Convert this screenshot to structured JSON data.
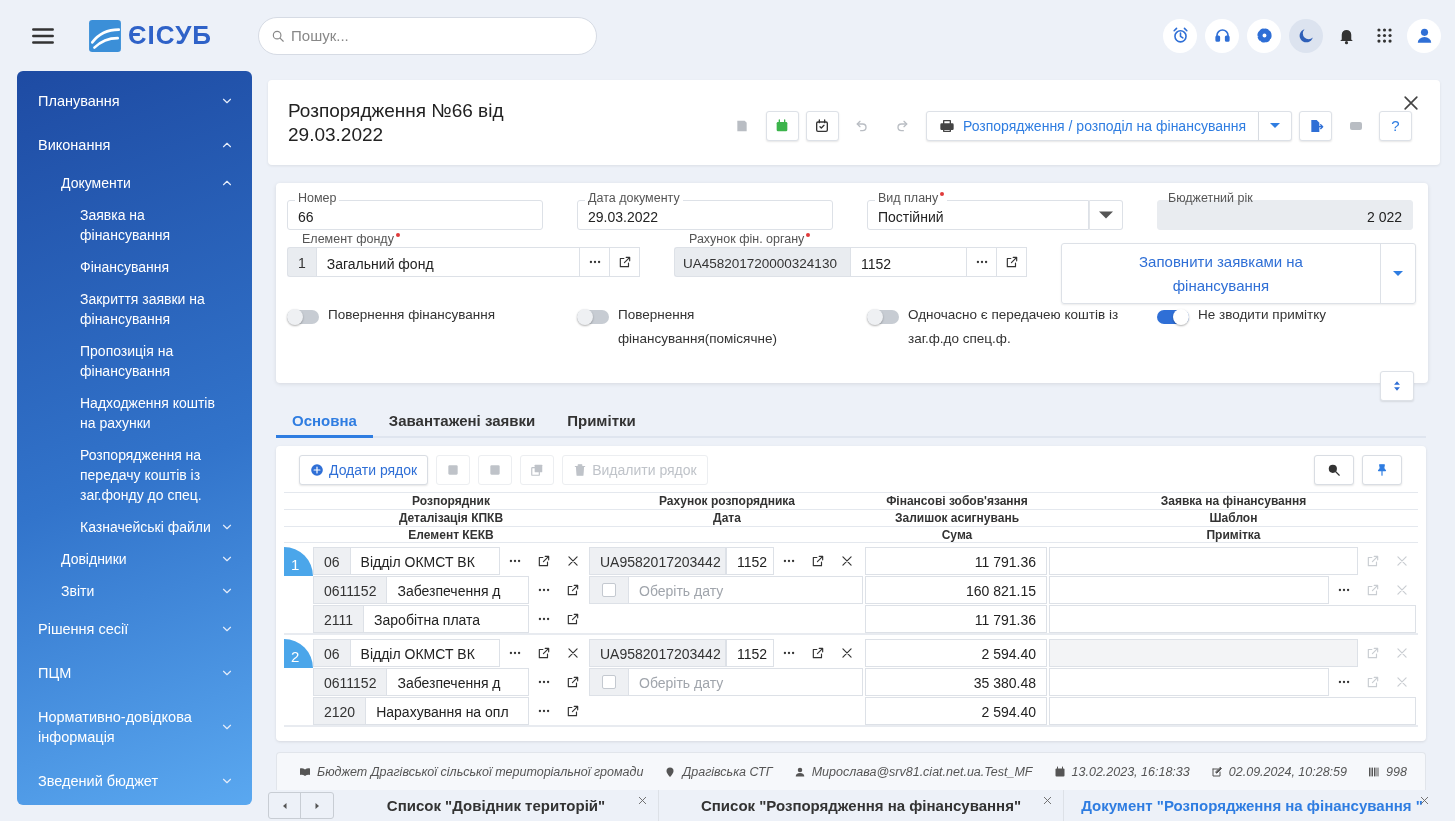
{
  "header": {
    "app_name": "ЄІСУБ",
    "search": {
      "placeholder": "Пошук..."
    }
  },
  "sidebar": {
    "items": [
      {
        "label": "Планування",
        "expanded": false
      },
      {
        "label": "Виконання",
        "expanded": true,
        "children": [
          {
            "label": "Документи",
            "expanded": true,
            "children": [
              {
                "label": "Заявка на фінансування"
              },
              {
                "label": "Фінансування"
              },
              {
                "label": "Закриття заявки на фінансування"
              },
              {
                "label": "Пропозиція на фінансування"
              },
              {
                "label": "Надходження коштів на рахунки"
              },
              {
                "label": "Розпорядження на передачу коштів із заг.фонду до спец."
              },
              {
                "label": "Казначейські файли",
                "expanded": false
              }
            ]
          },
          {
            "label": "Довідники",
            "expanded": false
          },
          {
            "label": "Звіти",
            "expanded": false
          }
        ]
      },
      {
        "label": "Рішення сесії",
        "expanded": false
      },
      {
        "label": "ПЦМ",
        "expanded": false
      },
      {
        "label": "Нормативно-довідкова інформація",
        "expanded": false
      },
      {
        "label": "Зведений бюджет",
        "expanded": false
      }
    ]
  },
  "document": {
    "title": "Розпорядження №66 від 29.03.2022",
    "toolbar": [
      {
        "kind": "save",
        "disabled": true
      },
      {
        "kind": "approve",
        "disabled": false
      },
      {
        "kind": "calendar",
        "disabled": false
      },
      {
        "kind": "undo",
        "disabled": true
      },
      {
        "kind": "redo",
        "disabled": true
      },
      {
        "kind": "print",
        "label": "Розпорядження / розподіл на фінансування",
        "disabled": false
      },
      {
        "kind": "export",
        "disabled": false
      },
      {
        "kind": "video",
        "disabled": true
      },
      {
        "kind": "help",
        "label": "?",
        "disabled": false
      }
    ]
  },
  "form": {
    "fields": [
      {
        "label": "Номер",
        "value": "66",
        "required": false,
        "disabled": false,
        "dropdown": false
      },
      {
        "label": "Дата документу",
        "value": "29.03.2022",
        "required": false,
        "disabled": false,
        "dropdown": false
      },
      {
        "label": "Вид плану",
        "value": "Постійний",
        "required": true,
        "disabled": false,
        "dropdown": true
      },
      {
        "label": "Бюджетний рік",
        "value": "2 022",
        "required": false,
        "disabled": true,
        "dropdown": false
      }
    ],
    "lookups": [
      {
        "label": "Елемент фонду",
        "code": "1",
        "value": "Загальний фонд",
        "required": true
      },
      {
        "label": "Рахунок фін. органу",
        "code": "UA458201720000324130",
        "value": "1152",
        "required": true
      }
    ],
    "fill_button": {
      "label": "Заповнити заявками на фінансування"
    },
    "toggles": [
      {
        "label": "Повернення фінансування",
        "on": false
      },
      {
        "label": "Повернення фінансування(помісячне)",
        "on": false
      },
      {
        "label": "Одночасно є передачею коштів із заг.ф.до спец.ф.",
        "on": false
      },
      {
        "label": "Не зводити примітку",
        "on": true
      }
    ]
  },
  "tabs": [
    {
      "label": "Основна",
      "selected": true
    },
    {
      "label": "Завантажені заявки",
      "selected": false
    },
    {
      "label": "Примітки",
      "selected": false
    }
  ],
  "table": {
    "toolbar": [
      {
        "kind": "add",
        "label": "Додати рядок",
        "disabled": false
      },
      {
        "kind": "up",
        "disabled": true
      },
      {
        "kind": "down",
        "disabled": true
      },
      {
        "kind": "copy",
        "disabled": true
      },
      {
        "kind": "delete",
        "label": "Видалити рядок",
        "disabled": true
      }
    ],
    "header_rows": [
      [
        "Розпорядник",
        "Рахунок розпорядника",
        "Фінансові зобов'язання",
        "Заявка на фінансування"
      ],
      [
        "Деталізація КПКВ",
        "Дата",
        "Залишок асигнувань",
        "Шаблон"
      ],
      [
        "Елемент КЕКВ",
        null,
        "Сума",
        "Примітка"
      ]
    ],
    "rows": [
      {
        "number": "1",
        "manager_code": "06",
        "manager_name": "Відділ ОКМСТ ВК",
        "account": "UA9582017203442",
        "account_code": "1152",
        "kpkv_code": "0611152",
        "kpkv_name": "Забезпечення д",
        "date_checked": false,
        "date_placeholder": "Оберіть дату",
        "kekv_code": "2111",
        "kekv_name": "Заробітна плата",
        "obligations": "11 791.36",
        "balance": "160 821.15",
        "sum": "11 791.36"
      },
      {
        "number": "2",
        "manager_code": "06",
        "manager_name": "Відділ ОКМСТ ВК",
        "account": "UA9582017203442",
        "account_code": "1152",
        "kpkv_code": "0611152",
        "kpkv_name": "Забезпечення д",
        "date_checked": false,
        "date_placeholder": "Оберіть дату",
        "kekv_code": "2120",
        "kekv_name": "Нарахування на опл",
        "obligations": "2 594.40",
        "balance": "35 380.48",
        "sum": "2 594.40"
      }
    ]
  },
  "info_bar": [
    {
      "kind": "budget",
      "text": "Бюджет Драгівської сільської територіальної громади"
    },
    {
      "kind": "location",
      "text": "Драгівська СТГ"
    },
    {
      "kind": "user",
      "text": "Мирослава@srv81.ciat.net.ua.Test_MF"
    },
    {
      "kind": "created",
      "text": "13.02.2023, 16:18:33"
    },
    {
      "kind": "edited",
      "text": "02.09.2024, 10:28:59"
    },
    {
      "kind": "id",
      "text": "998"
    }
  ],
  "open_tabs": [
    {
      "label": "Список \"Довідник територій\"",
      "selected": false
    },
    {
      "label": "Список \"Розпорядження на фінансування\"",
      "selected": false
    },
    {
      "label": "Документ \"Розпорядження на фінансування \"",
      "selected": true
    }
  ]
}
